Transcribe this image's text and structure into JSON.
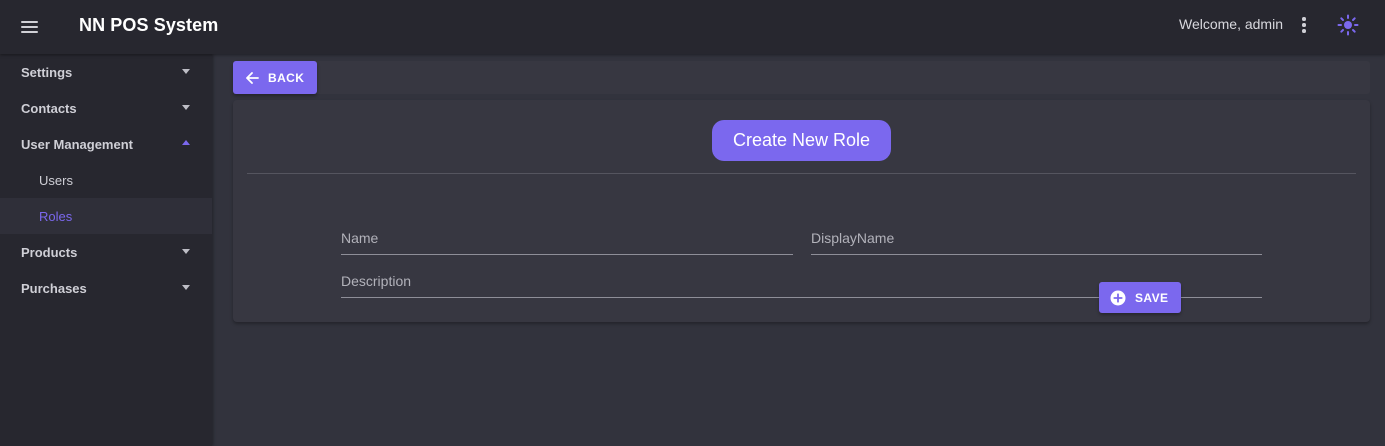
{
  "appbar": {
    "menu_icon": "hamburger-menu-icon",
    "title": "NN POS System",
    "welcome": "Welcome, admin",
    "more_icon": "more-vertical-icon",
    "theme_icon": "sun-icon"
  },
  "sidebar": {
    "items": [
      {
        "label": "Settings",
        "expanded": false
      },
      {
        "label": "Contacts",
        "expanded": false
      },
      {
        "label": "User Management",
        "expanded": true,
        "children": [
          {
            "label": "Users",
            "active": false
          },
          {
            "label": "Roles",
            "active": true
          }
        ]
      },
      {
        "label": "Products",
        "expanded": false
      },
      {
        "label": "Purchases",
        "expanded": false
      }
    ]
  },
  "toolbar": {
    "back_label": "BACK",
    "back_icon": "arrow-left-icon"
  },
  "form": {
    "title": "Create New Role",
    "name_label": "Name",
    "name_value": "",
    "display_name_label": "DisplayName",
    "display_name_value": "",
    "description_label": "Description",
    "description_value": "",
    "save_label": "SAVE",
    "save_icon": "plus-circle-icon"
  },
  "colors": {
    "accent": "#7b68ee",
    "appbar_bg": "#27272f",
    "content_bg": "#32333d",
    "card_bg": "#373741"
  }
}
